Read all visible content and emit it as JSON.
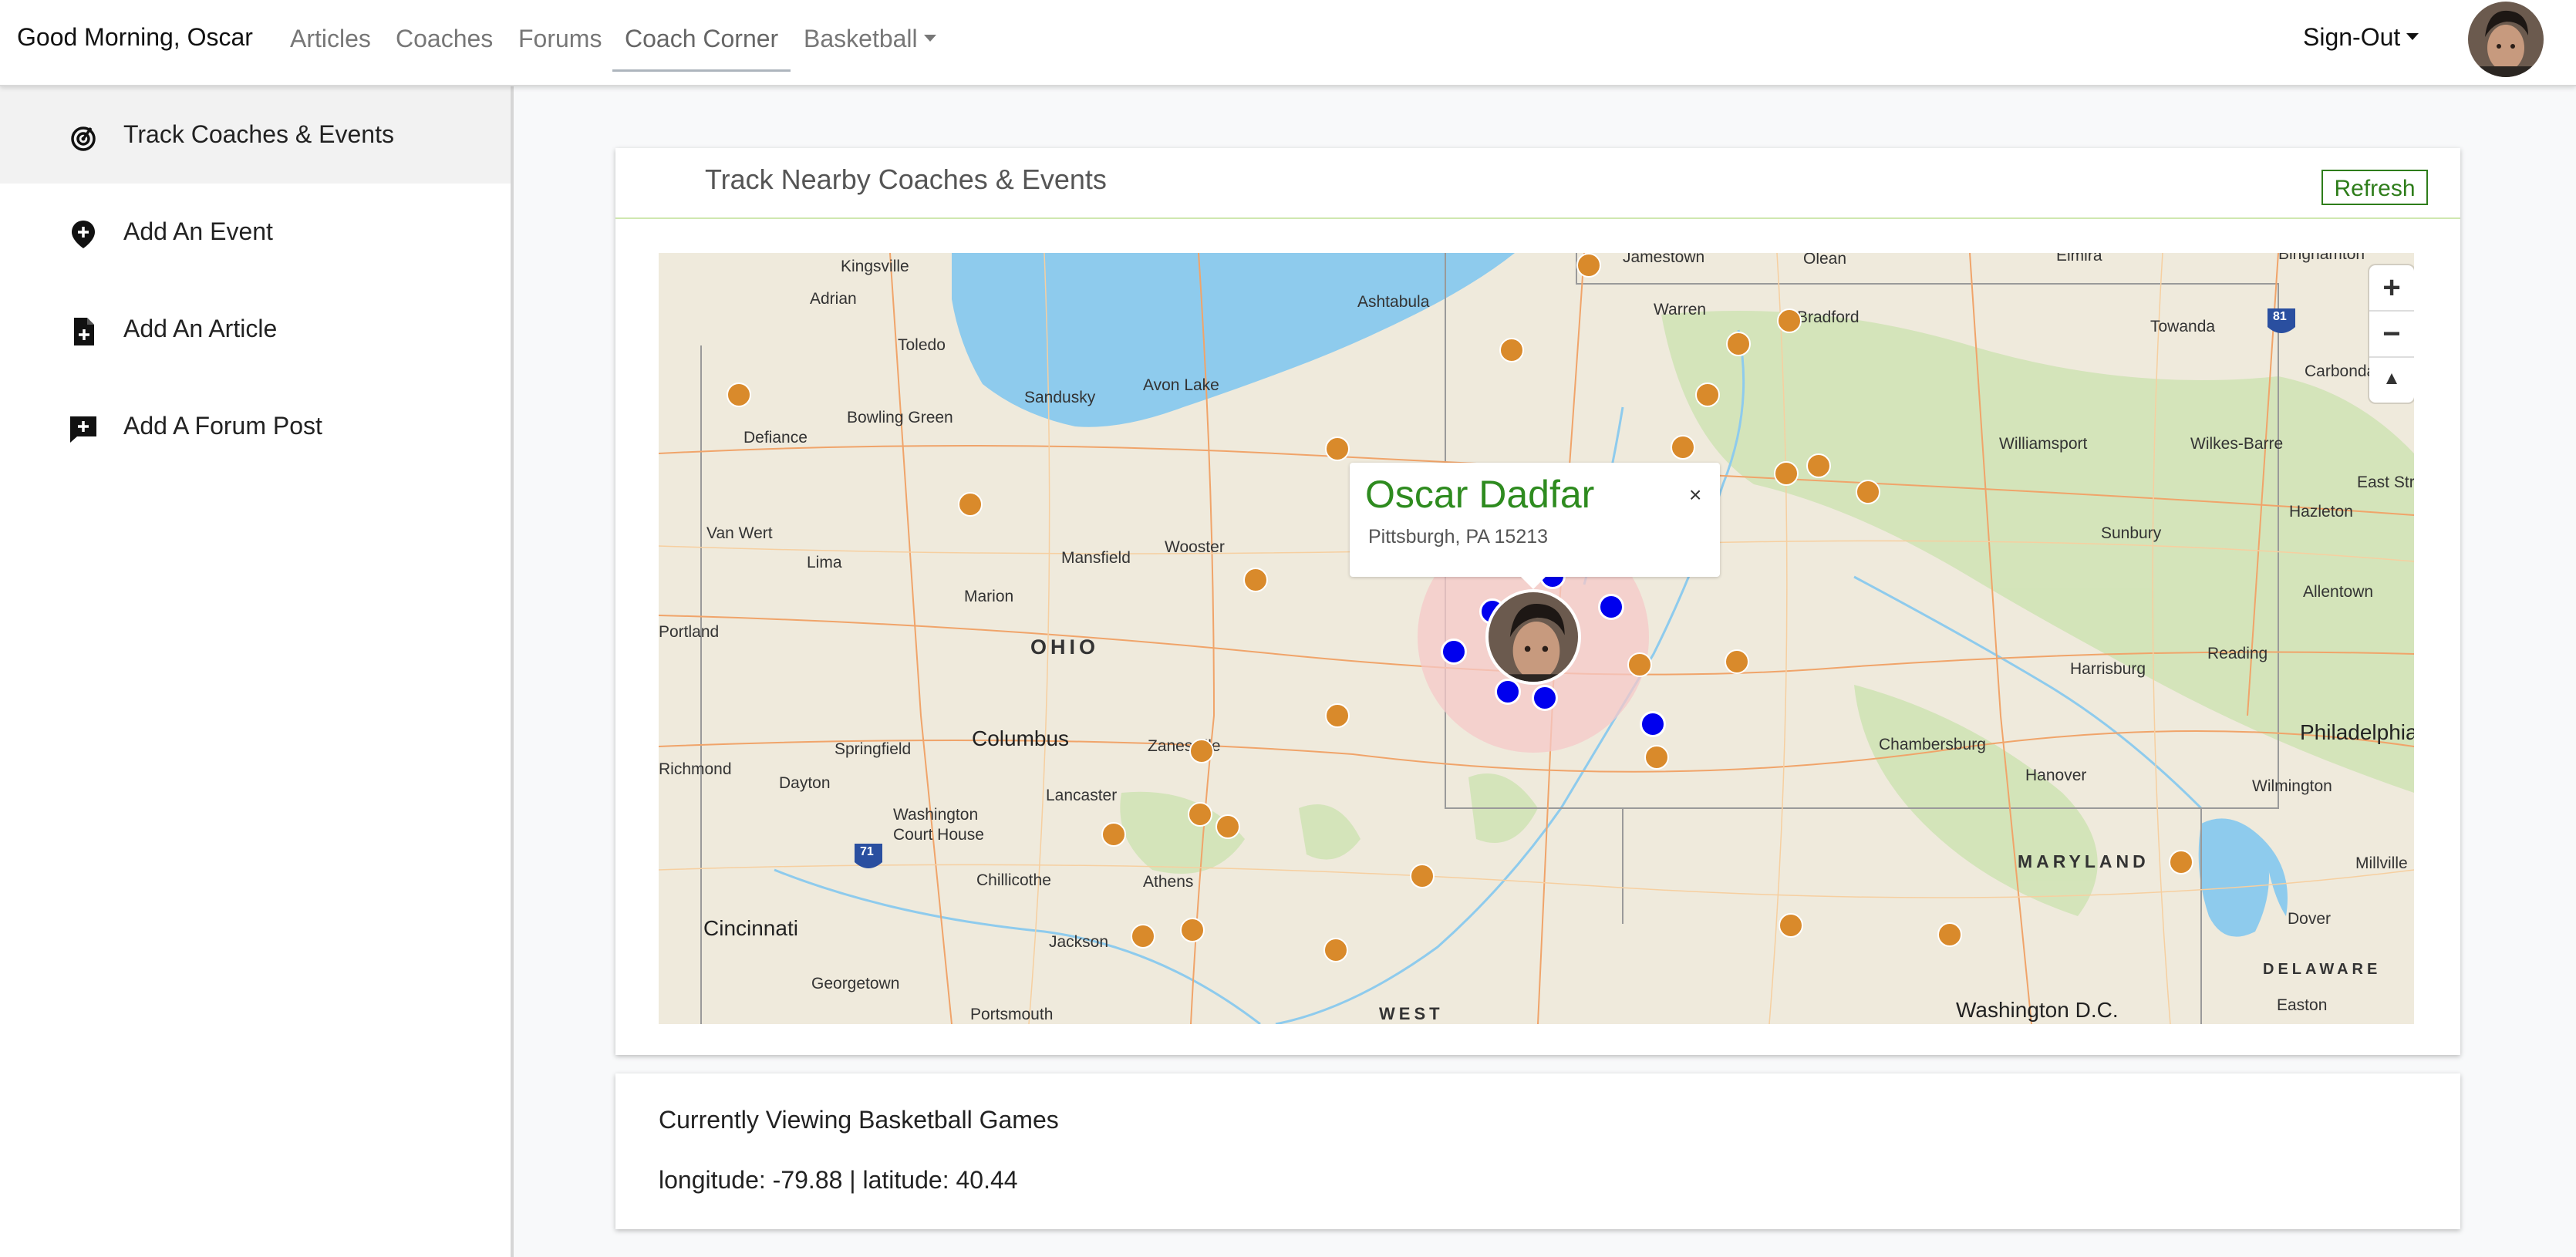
{
  "navbar": {
    "greeting": "Good Morning, Oscar",
    "links": [
      "Articles",
      "Coaches",
      "Forums",
      "Coach Corner",
      "Basketball"
    ],
    "signout_label": "Sign-Out"
  },
  "sidebar": {
    "items": [
      {
        "label": "Track Coaches & Events",
        "icon": "radar-icon"
      },
      {
        "label": "Add An Event",
        "icon": "map-pin-plus-icon"
      },
      {
        "label": "Add An Article",
        "icon": "file-plus-icon"
      },
      {
        "label": "Add A Forum Post",
        "icon": "message-plus-icon"
      }
    ]
  },
  "map_card": {
    "title": "Track Nearby Coaches & Events",
    "refresh_label": "Refresh"
  },
  "map": {
    "cities": [
      "Kingsville",
      "Jamestown",
      "Olean",
      "Elmira",
      "Binghamton",
      "Adrian",
      "Ashtabula",
      "Warren",
      "Bradford",
      "Toledo",
      "Towanda",
      "Carbondale",
      "Sandusky",
      "Avon Lake",
      "Defiance",
      "Bowling Green",
      "Williamsport",
      "Wilkes-Barre",
      "Van Wert",
      "Lima",
      "Mansfield",
      "Wooster",
      "Hazleton",
      "East Stroudsburg",
      "Sunbury",
      "Marion",
      "Allentown",
      "Harrisburg",
      "Reading",
      "Springfield",
      "Columbus",
      "Zanesville",
      "Lancaster",
      "Chambersburg",
      "Hanover",
      "Dayton",
      "Washington Court House",
      "Wilmington",
      "Chillicothe",
      "Athens",
      "Millville",
      "Cincinnati",
      "Jackson",
      "Dover",
      "Georgetown",
      "Portsmouth",
      "Easton",
      "Washington D.C.",
      "Richmond",
      "Portland",
      "Philadelphia"
    ],
    "states": [
      "OHIO",
      "MARYLAND",
      "DELAWARE",
      "WEST"
    ],
    "highways": [
      "81",
      "71"
    ],
    "zoom_in": "+",
    "zoom_out": "−",
    "compass": "▲",
    "popup": {
      "name": "Oscar Dadfar",
      "location": "Pittsburgh, PA 15213",
      "close": "×"
    },
    "colors": {
      "event_marker": "#d98a2b",
      "coach_marker": "#0000ee",
      "water": "#8ecbed",
      "land": "#efeadc",
      "user_radius": "#f6c8c8"
    }
  },
  "info_card": {
    "title": "Currently Viewing Basketball Games",
    "coords": "longitude: -79.88 | latitude: 40.44"
  }
}
